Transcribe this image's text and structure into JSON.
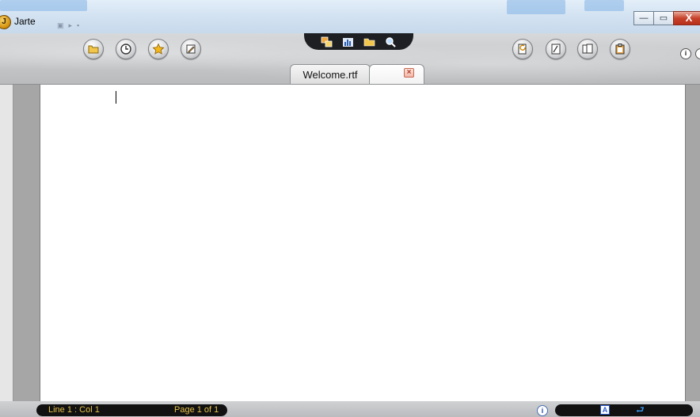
{
  "window": {
    "title": "Jarte",
    "app_icon_letter": "J",
    "minimize_glyph": "—",
    "maximize_glyph": "▭",
    "close_glyph": "X"
  },
  "toolbar": {
    "left_buttons": [
      "open-folder-icon",
      "recent-files-clock-icon",
      "favorites-star-icon",
      "edit-notes-icon"
    ],
    "center_buttons": [
      "compare-windows-icon",
      "chart-icon",
      "folder-icon",
      "find-magnifier-icon"
    ],
    "right_buttons": [
      "refresh-document-icon",
      "page-layout-icon",
      "two-pages-icon",
      "clipboard-icon"
    ],
    "info_badge": "i"
  },
  "tabs": [
    {
      "label": "Welcome.rtf",
      "active": false
    },
    {
      "label": "",
      "active": true,
      "close_glyph": "×"
    }
  ],
  "status": {
    "position": "Line 1 : Col 1",
    "page": "Page 1 of 1",
    "info_glyph": "i",
    "font_glyph": "A",
    "wrap_glyph": "⮐"
  },
  "colors": {
    "status_text": "#e3c14a",
    "close_button": "#c6422b"
  }
}
